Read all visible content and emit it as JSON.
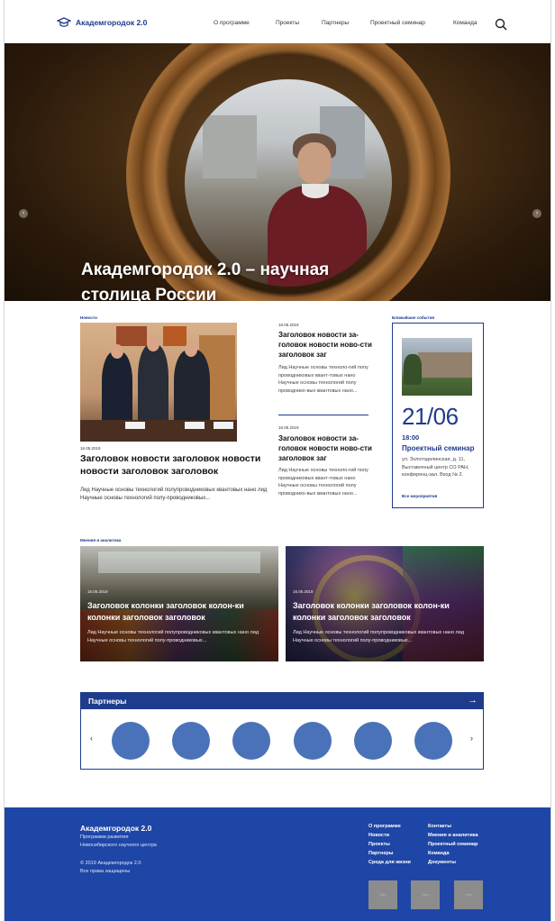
{
  "header": {
    "logo_text": "Академгородок 2.0",
    "nav": [
      "О программе",
      "Проекты",
      "Партнеры",
      "Проектный семинар",
      "Команда"
    ]
  },
  "hero": {
    "title": "Академгородок 2.0 – научная столица России"
  },
  "news": {
    "section_label": "Новости",
    "main": {
      "date": "16.05.2019",
      "title": "Заголовок новости заголовок новости новости заголовок заголовок",
      "text": "Лид Научные основы технологий полупроводниковых квантовых нано лид Научные основы технологий полу-проводниковых..."
    },
    "side": [
      {
        "date": "16.05.2019",
        "title": "Заголовок новости за-головок новости ново-сти заголовок заг",
        "text": "Лид Научные основы техноло-гий полу проводниковых квант-товых нано Научные основы технологий полу проводнико-вых квантовых нано..."
      },
      {
        "date": "16.05.2019",
        "title": "Заголовок новости за-головок новости ново-сти заголовок заг",
        "text": "Лид Научные основы техноло-гий полу проводниковых квант-товых нано Научные основы технологий полу проводнико-вых квантовых нано..."
      }
    ]
  },
  "event": {
    "section_label": "Ближайшие события",
    "day": "21/06",
    "time": "18:00",
    "title": "Проектный семинар",
    "address": "ул. Золотодолинская, д. 11, Выставочный центр СО РАН, конференц-зал. Вход № 2.",
    "all_link": "Все мероприятия"
  },
  "opinions": {
    "section_label": "Мнения и аналитика",
    "cards": [
      {
        "date": "16.05.2019",
        "title": "Заголовок колонки заголовок колон-ки колонки заголовок заголовок",
        "text": "Лид Научные основы технологий полупроводниковых квантовых нано лид Научные основы технологий полу-проводниковых..."
      },
      {
        "date": "16.05.2019",
        "title": "Заголовок колонки заголовок колон-ки колонки заголовок заголовок",
        "text": "Лид Научные основы технологий полупроводниковых квантовых нано лид Научные основы технологий полу-проводниковых..."
      }
    ]
  },
  "partners": {
    "title": "Партнеры",
    "arrow": "→",
    "prev": "‹",
    "next": "›"
  },
  "footer": {
    "brand": "Академгородок 2.0",
    "sub1": "Программа развития",
    "sub2": "Новосибирского научного центра",
    "copy1": "© 2019 Академгородок 2.0",
    "copy2": "Все права защищены",
    "col1": [
      "О программе",
      "Новости",
      "Проекты",
      "Партнеры",
      "Среда для жизни"
    ],
    "col2": [
      "Контакты",
      "Мнения и аналитика",
      "Проектный семинар",
      "Команда",
      "Документы"
    ],
    "boxes": [
      "Лого",
      "Лого",
      "Лого"
    ]
  },
  "colors": {
    "brand_blue": "#1f3b8c",
    "footer_blue": "#1e46a6",
    "partner_circle": "#4a72b8"
  }
}
